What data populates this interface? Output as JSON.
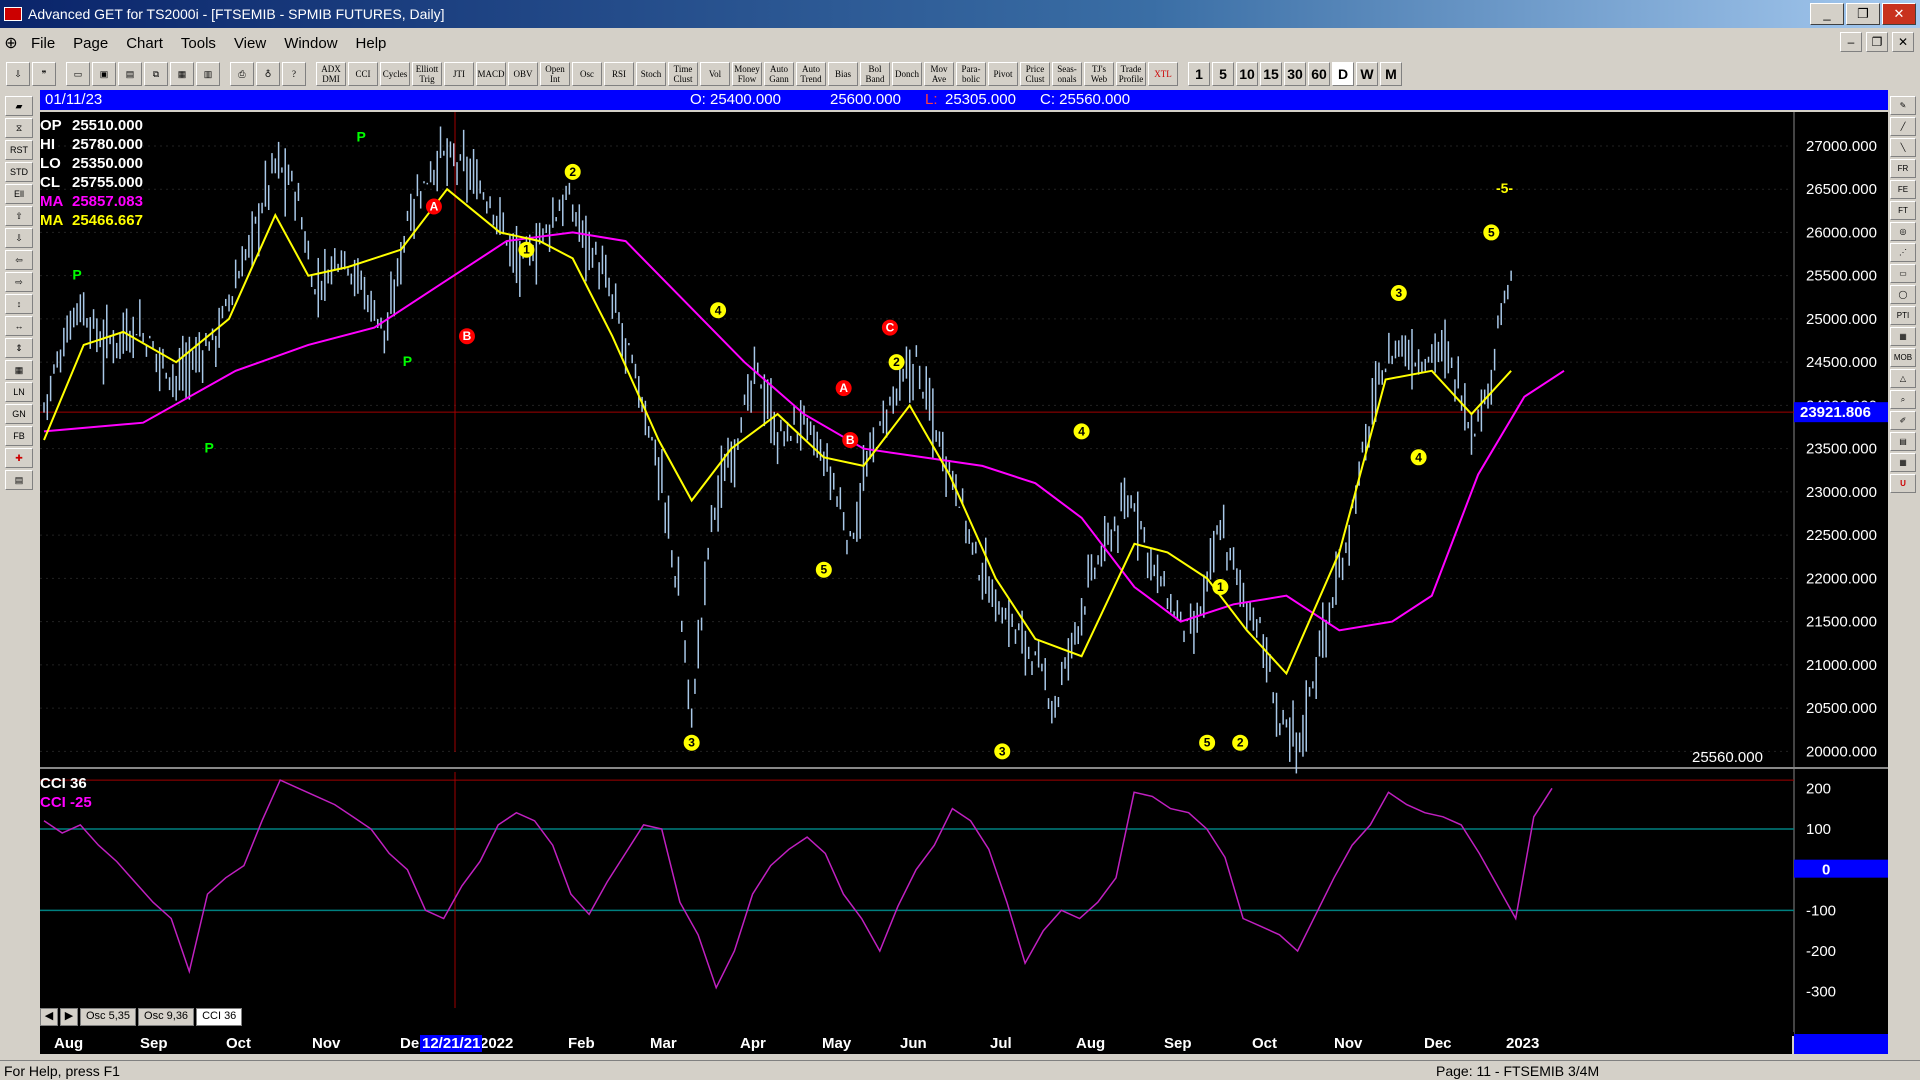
{
  "window": {
    "title": "Advanced GET for TS2000i - [FTSEMIB - SPMIB FUTURES, Daily]"
  },
  "menu": [
    "File",
    "Page",
    "Chart",
    "Tools",
    "View",
    "Window",
    "Help"
  ],
  "toolbar": {
    "study_buttons": [
      "ADX DMI",
      "CCI",
      "Cycles",
      "Elliott Trig",
      "JTI",
      "MACD",
      "OBV",
      "Open Int",
      "Osc",
      "RSI",
      "Stoch",
      "Time Clust",
      "Vol",
      "Money Flow",
      "Auto Gann",
      "Auto Trend",
      "Bias",
      "Bol Band",
      "Donch",
      "Mov Ave",
      "Para-bolic",
      "Pivot",
      "Price Clust",
      "Seas-onals",
      "TJ's Web",
      "Trade Profile",
      "XTL"
    ],
    "timeframes": [
      "1",
      "5",
      "10",
      "15",
      "30",
      "60",
      "D",
      "W",
      "M"
    ],
    "active_timeframe": "D"
  },
  "infobar": {
    "date": "01/11/23",
    "open": "O: 25400.000",
    "high": "25600.000",
    "low_label": "L:",
    "low": "25305.000",
    "close": "C: 25560.000"
  },
  "readout": [
    {
      "label": "OP",
      "value": "25510.000",
      "color": "#ffffff"
    },
    {
      "label": "HI",
      "value": "25780.000",
      "color": "#ffffff"
    },
    {
      "label": "LO",
      "value": "25350.000",
      "color": "#ffffff"
    },
    {
      "label": "CL",
      "value": "25755.000",
      "color": "#ffffff"
    },
    {
      "label": "MA",
      "value": "25857.083",
      "color": "#ff00ff"
    },
    {
      "label": "MA",
      "value": "25466.667",
      "color": "#ffff00"
    }
  ],
  "osc_readout": [
    {
      "label": "CCI 36",
      "value": "",
      "color": "#ffffff"
    },
    {
      "label": "CCI",
      "value": "-25",
      "color": "#ff00ff"
    }
  ],
  "tabs": [
    "Osc 5,35",
    "Osc 9,36",
    "CCI 36"
  ],
  "active_tab": "CCI 36",
  "status": {
    "help": "For Help, press F1",
    "page": "Page: 11 - FTSEMIB 3/4M"
  },
  "colors": {
    "background": "#000000",
    "price": "#a8c8e8",
    "ma_fast": "#ffff00",
    "ma_slow": "#ff00ff",
    "cci": "#c020c0",
    "infobar": "#0000ff"
  },
  "chart_data": [
    {
      "type": "candlestick",
      "title": "FTSEMIB - SPMIB FUTURES, Daily",
      "yticks": [
        "20000.000",
        "20500.000",
        "21000.000",
        "21500.000",
        "22000.000",
        "22500.000",
        "23000.000",
        "23500.000",
        "24000.000",
        "24500.000",
        "25000.000",
        "25500.000",
        "26000.000",
        "26500.000",
        "27000.000"
      ],
      "ylim": [
        19900,
        27300
      ],
      "current_level": "23921.806",
      "last_price": "25560.000",
      "xticks": [
        "Aug",
        "Sep",
        "Oct",
        "Nov",
        "De",
        "2022",
        "Feb",
        "Mar",
        "Apr",
        "May",
        "Jun",
        "Jul",
        "Aug",
        "Sep",
        "Oct",
        "Nov",
        "Dec",
        "2023"
      ],
      "cursor_date": "12/21/21",
      "close_path": [
        [
          0,
          24000
        ],
        [
          10,
          25200
        ],
        [
          18,
          24700
        ],
        [
          28,
          24900
        ],
        [
          40,
          24300
        ],
        [
          52,
          24800
        ],
        [
          60,
          25600
        ],
        [
          70,
          26800
        ],
        [
          76,
          26500
        ],
        [
          82,
          25300
        ],
        [
          90,
          25800
        ],
        [
          96,
          25400
        ],
        [
          104,
          24800
        ],
        [
          110,
          26200
        ],
        [
          120,
          26900
        ],
        [
          128,
          26700
        ],
        [
          136,
          26300
        ],
        [
          144,
          25600
        ],
        [
          150,
          25900
        ],
        [
          158,
          26400
        ],
        [
          166,
          25800
        ],
        [
          172,
          25200
        ],
        [
          180,
          24200
        ],
        [
          186,
          23300
        ],
        [
          192,
          21800
        ],
        [
          196,
          20400
        ],
        [
          202,
          22700
        ],
        [
          210,
          23700
        ],
        [
          216,
          24400
        ],
        [
          222,
          23600
        ],
        [
          230,
          23800
        ],
        [
          238,
          23200
        ],
        [
          244,
          22400
        ],
        [
          250,
          23400
        ],
        [
          256,
          24000
        ],
        [
          264,
          24500
        ],
        [
          270,
          23700
        ],
        [
          276,
          23100
        ],
        [
          282,
          22200
        ],
        [
          290,
          21600
        ],
        [
          298,
          21200
        ],
        [
          306,
          20500
        ],
        [
          312,
          21400
        ],
        [
          318,
          22100
        ],
        [
          324,
          22600
        ],
        [
          330,
          22900
        ],
        [
          336,
          22100
        ],
        [
          342,
          21600
        ],
        [
          348,
          21300
        ],
        [
          356,
          22600
        ],
        [
          362,
          21900
        ],
        [
          368,
          21400
        ],
        [
          374,
          20300
        ],
        [
          380,
          20100
        ],
        [
          386,
          21200
        ],
        [
          392,
          22000
        ],
        [
          398,
          23200
        ],
        [
          404,
          24300
        ],
        [
          410,
          24700
        ],
        [
          416,
          24500
        ],
        [
          422,
          24700
        ],
        [
          428,
          24300
        ],
        [
          432,
          23700
        ],
        [
          436,
          24000
        ],
        [
          440,
          24900
        ],
        [
          444,
          25400
        ]
      ],
      "ma_fast_path": [
        [
          0,
          23600
        ],
        [
          12,
          24700
        ],
        [
          24,
          24850
        ],
        [
          40,
          24500
        ],
        [
          56,
          25000
        ],
        [
          70,
          26200
        ],
        [
          80,
          25500
        ],
        [
          92,
          25600
        ],
        [
          108,
          25800
        ],
        [
          122,
          26500
        ],
        [
          138,
          26000
        ],
        [
          150,
          25900
        ],
        [
          160,
          25700
        ],
        [
          172,
          24800
        ],
        [
          186,
          23600
        ],
        [
          196,
          22900
        ],
        [
          208,
          23500
        ],
        [
          222,
          23900
        ],
        [
          236,
          23400
        ],
        [
          248,
          23300
        ],
        [
          262,
          24000
        ],
        [
          274,
          23200
        ],
        [
          288,
          22000
        ],
        [
          300,
          21300
        ],
        [
          314,
          21100
        ],
        [
          330,
          22400
        ],
        [
          340,
          22300
        ],
        [
          352,
          22000
        ],
        [
          364,
          21400
        ],
        [
          376,
          20900
        ],
        [
          392,
          22300
        ],
        [
          406,
          24300
        ],
        [
          420,
          24400
        ],
        [
          432,
          23900
        ],
        [
          444,
          24400
        ]
      ],
      "ma_slow_path": [
        [
          0,
          23700
        ],
        [
          30,
          23800
        ],
        [
          58,
          24400
        ],
        [
          80,
          24700
        ],
        [
          100,
          24900
        ],
        [
          120,
          25400
        ],
        [
          140,
          25900
        ],
        [
          160,
          26000
        ],
        [
          176,
          25900
        ],
        [
          194,
          25200
        ],
        [
          212,
          24500
        ],
        [
          230,
          23900
        ],
        [
          248,
          23500
        ],
        [
          266,
          23400
        ],
        [
          284,
          23300
        ],
        [
          300,
          23100
        ],
        [
          314,
          22700
        ],
        [
          330,
          21900
        ],
        [
          344,
          21500
        ],
        [
          360,
          21700
        ],
        [
          376,
          21800
        ],
        [
          392,
          21400
        ],
        [
          408,
          21500
        ],
        [
          420,
          21800
        ],
        [
          434,
          23200
        ],
        [
          448,
          24100
        ],
        [
          460,
          24400
        ]
      ],
      "wave_labels": [
        {
          "text": "P",
          "color": "#00ff00"
        },
        {
          "text": "A",
          "color": "#ff0000"
        },
        {
          "text": "B",
          "color": "#ff0000"
        },
        {
          "text": "1",
          "color": "#ffff00"
        },
        {
          "text": "2",
          "color": "#ffff00"
        },
        {
          "text": "3",
          "color": "#ffff00"
        },
        {
          "text": "4",
          "color": "#ffff00"
        },
        {
          "text": "5",
          "color": "#ffff00"
        },
        {
          "text": "-5-",
          "color": "#ffff00"
        }
      ]
    },
    {
      "type": "line",
      "title": "CCI 36",
      "yticks": [
        "200",
        "100",
        "0",
        "-100",
        "-200",
        "-300"
      ],
      "ylim": [
        -340,
        240
      ],
      "zero_label": "0",
      "reference_lines": [
        100,
        -100
      ],
      "values": [
        120,
        90,
        110,
        60,
        20,
        -30,
        -80,
        -120,
        -250,
        -60,
        -20,
        10,
        120,
        220,
        200,
        180,
        160,
        130,
        100,
        40,
        0,
        -100,
        -120,
        -40,
        20,
        110,
        140,
        120,
        60,
        -60,
        -110,
        -30,
        40,
        110,
        100,
        -80,
        -160,
        -290,
        -200,
        -60,
        10,
        50,
        80,
        40,
        -60,
        -120,
        -200,
        -90,
        0,
        60,
        150,
        120,
        50,
        -80,
        -230,
        -150,
        -100,
        -120,
        -80,
        -20,
        190,
        180,
        150,
        140,
        100,
        30,
        -120,
        -140,
        -160,
        -200,
        -110,
        -20,
        60,
        110,
        190,
        160,
        140,
        130,
        110,
        40,
        -40,
        -120,
        130,
        200
      ]
    }
  ]
}
